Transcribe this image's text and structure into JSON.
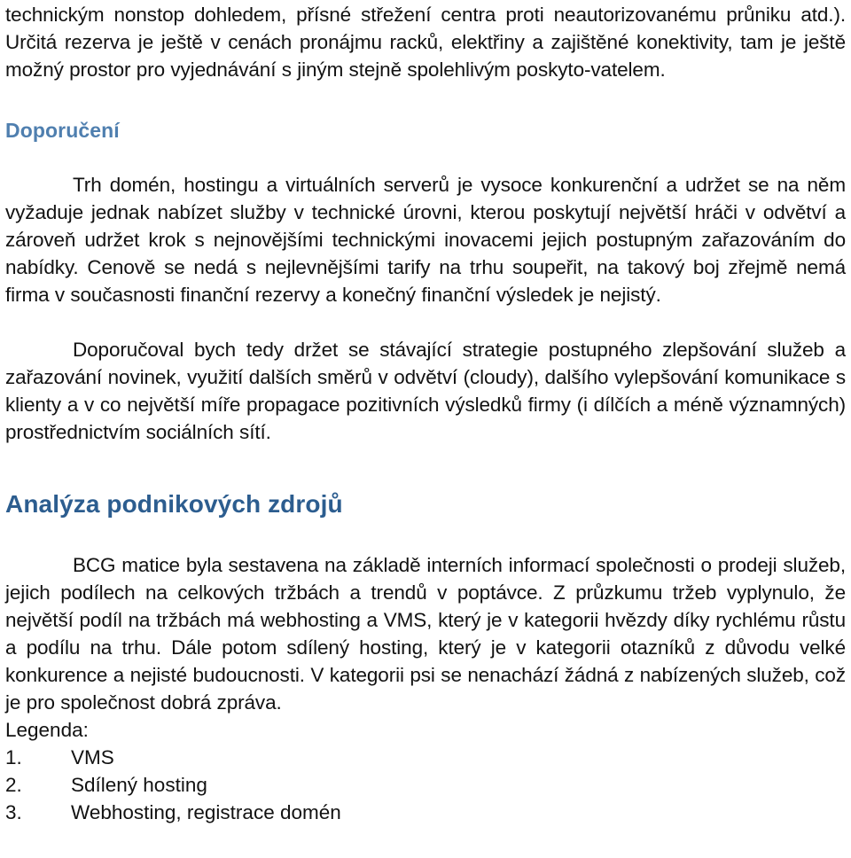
{
  "document": {
    "language": "cs",
    "colors": {
      "heading_recommendation": "#4F7FAF",
      "heading_analysis": "#2C5D8F",
      "body_text": "#121212",
      "page_background": "#FFFFFF"
    },
    "continuation_paragraph": "technickým nonstop dohledem, přísné střežení centra proti neautorizovanému průniku atd.). Určitá rezerva je ještě v cenách pronájmu racků, elektřiny a zajištěné konektivity, tam je ještě možný prostor pro vyjednávání s jiným stejně spolehlivým poskyto-vatelem.",
    "section_recommendation": {
      "heading": "Doporučení",
      "paragraph_1": "Trh domén, hostingu a virtuálních serverů je vysoce konkurenční a udržet se na něm vyžaduje jednak nabízet služby v technické úrovni, kterou poskytují největší hráči v odvětví a zároveň udržet krok s nejnovějšími technickými inovacemi jejich postupným zařazováním do nabídky. Cenově se nedá s nejlevnějšími tarify na trhu soupeřit, na takový boj zřejmě nemá firma v současnosti finanční rezervy a konečný finanční výsledek je nejistý.",
      "paragraph_2": "Doporučoval bych tedy držet se stávající strategie postupného zlepšování služeb a zařazování novinek, využití dalších směrů v odvětví (cloudy), dalšího vylepšování komunikace s klienty a v co největší míře propagace pozitivních výsledků firmy (i dílčích a méně významných) prostřednictvím sociálních sítí."
    },
    "section_analysis": {
      "heading": "Analýza podnikových zdrojů",
      "paragraph_1": "BCG matice byla sestavena na základě interních informací společnosti o prodeji služeb, jejich podílech na celkových tržbách a trendů v poptávce. Z průzkumu tržeb vyplynulo, že největší podíl na tržbách má webhosting a VMS, který je v kategorii hvězdy díky rychlému růstu a podílu na trhu. Dále potom sdílený hosting, který je v kategorii otazníků z důvodu velké konkurence a nejisté budoucnosti. V kategorii psi se nenachází žádná z nabízených služeb, což je pro společnost dobrá zpráva.",
      "legend": {
        "title": "Legenda:",
        "items": [
          {
            "number": "1.",
            "label": "VMS"
          },
          {
            "number": "2.",
            "label": "Sdílený hosting"
          },
          {
            "number": "3.",
            "label": "Webhosting, registrace domén"
          }
        ]
      }
    }
  }
}
